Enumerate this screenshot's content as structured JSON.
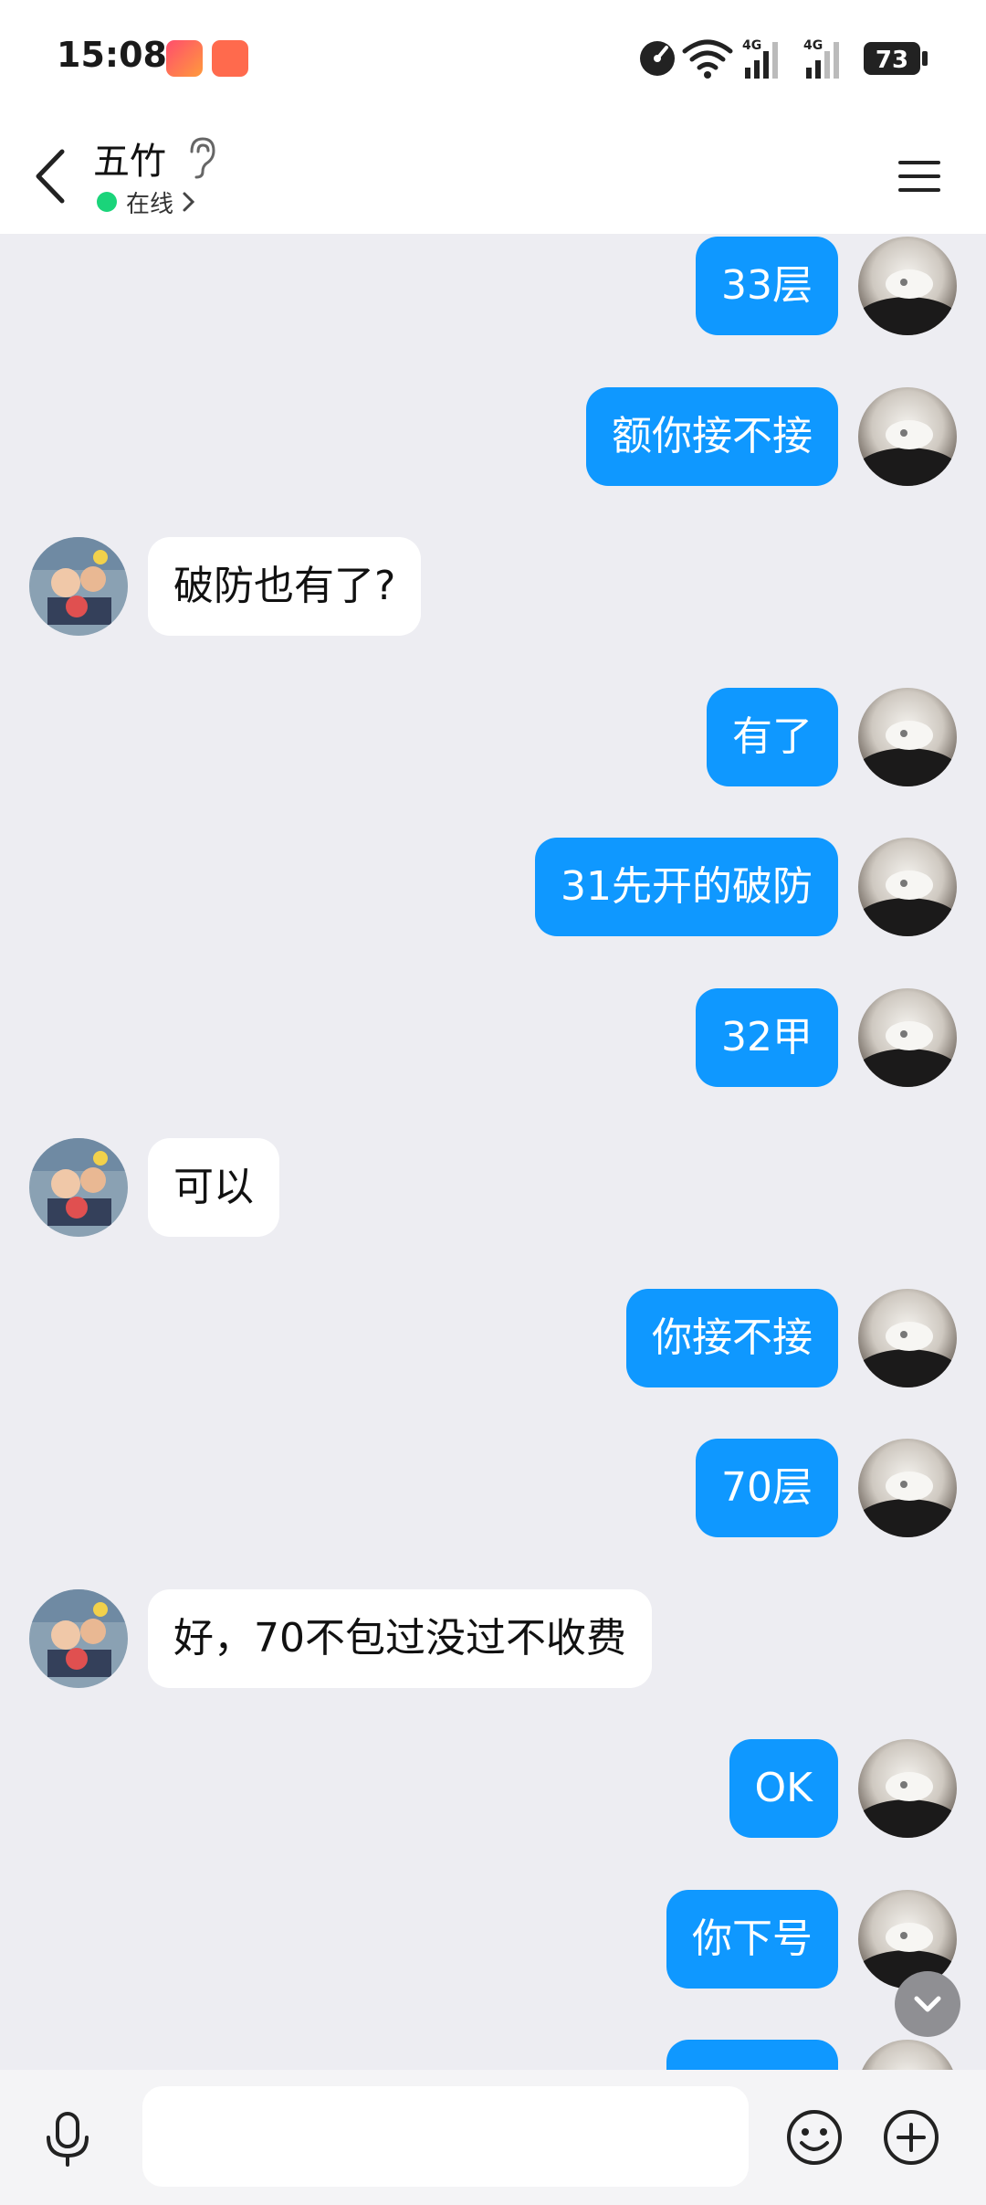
{
  "status_bar": {
    "time": "15:08",
    "battery": "73",
    "network_1": "4G",
    "network_2": "4G"
  },
  "header": {
    "contact_name": "五竹",
    "status": "在线"
  },
  "colors": {
    "my_bubble": "#0f98ff",
    "their_bubble": "#ffffff",
    "online": "#1ad47a",
    "background": "#ededf2"
  },
  "messages": [
    {
      "sender": "me",
      "text": "33层"
    },
    {
      "sender": "me",
      "text": "额你接不接"
    },
    {
      "sender": "them",
      "text": "破防也有了?"
    },
    {
      "sender": "me",
      "text": "有了"
    },
    {
      "sender": "me",
      "text": "31先开的破防"
    },
    {
      "sender": "me",
      "text": "32甲"
    },
    {
      "sender": "them",
      "text": "可以"
    },
    {
      "sender": "me",
      "text": "你接不接"
    },
    {
      "sender": "me",
      "text": "70层"
    },
    {
      "sender": "them",
      "text": "好，70不包过没过不收费"
    },
    {
      "sender": "me",
      "text": "OK"
    },
    {
      "sender": "me",
      "text": "你下号"
    },
    {
      "sender": "me",
      "text": ""
    }
  ],
  "input": {
    "value": "",
    "placeholder": ""
  },
  "icons": {
    "back": "chevron-left-icon",
    "ear": "ear-icon",
    "menu": "hamburger-menu-icon",
    "mic": "microphone-icon",
    "emoji": "smiley-icon",
    "plus": "plus-circle-icon",
    "scroll": "chevron-down-icon"
  }
}
